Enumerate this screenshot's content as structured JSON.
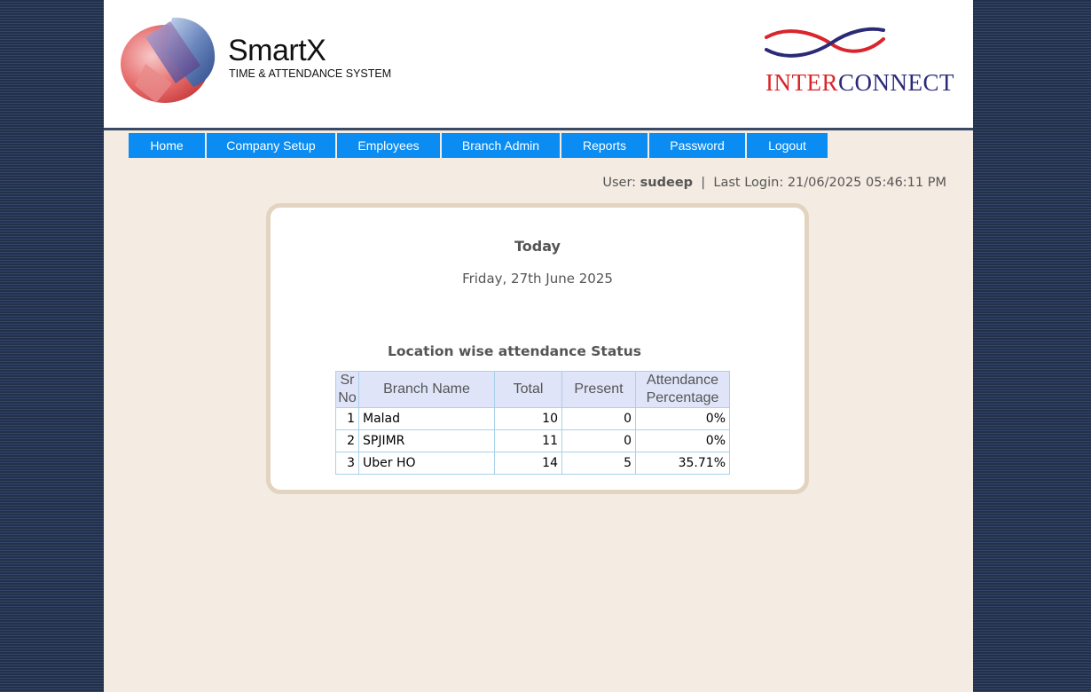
{
  "header": {
    "brand_name": "SmartX",
    "brand_sub": "TIME & ATTENDANCE SYSTEM",
    "partner_logo_part1": "INTER",
    "partner_logo_part2": "CONNECT"
  },
  "nav": {
    "items": [
      "Home",
      "Company Setup",
      "Employees",
      "Branch Admin",
      "Reports",
      "Password",
      "Logout"
    ]
  },
  "user_info": {
    "user_label": "User:",
    "username": "sudeep",
    "separator": "|",
    "last_login_label": "Last Login:",
    "last_login": "21/06/2025 05:46:11 PM"
  },
  "today": {
    "title": "Today",
    "date": "Friday, 27th June 2025"
  },
  "attendance": {
    "title": "Location wise attendance Status",
    "columns": [
      {
        "line1": "Sr",
        "line2": "No"
      },
      {
        "line1": "Branch Name",
        "line2": ""
      },
      {
        "line1": "Total",
        "line2": ""
      },
      {
        "line1": "Present",
        "line2": ""
      },
      {
        "line1": "Attendance",
        "line2": "Percentage"
      }
    ],
    "rows": [
      {
        "sr": "1",
        "branch": "Malad",
        "total": "10",
        "present": "0",
        "percentage": "0%"
      },
      {
        "sr": "2",
        "branch": "SPJIMR",
        "total": "11",
        "present": "0",
        "percentage": "0%"
      },
      {
        "sr": "3",
        "branch": "Uber HO",
        "total": "14",
        "present": "5",
        "percentage": "35.71%"
      }
    ]
  },
  "colors": {
    "nav_bg": "#0a8cf2",
    "page_bg": "#f4ebe2",
    "table_header_bg": "#dfe4f8",
    "table_border": "#a9d1ea"
  },
  "icons": [
    "smartx-logo-icon",
    "interconnect-swoosh-icon"
  ]
}
